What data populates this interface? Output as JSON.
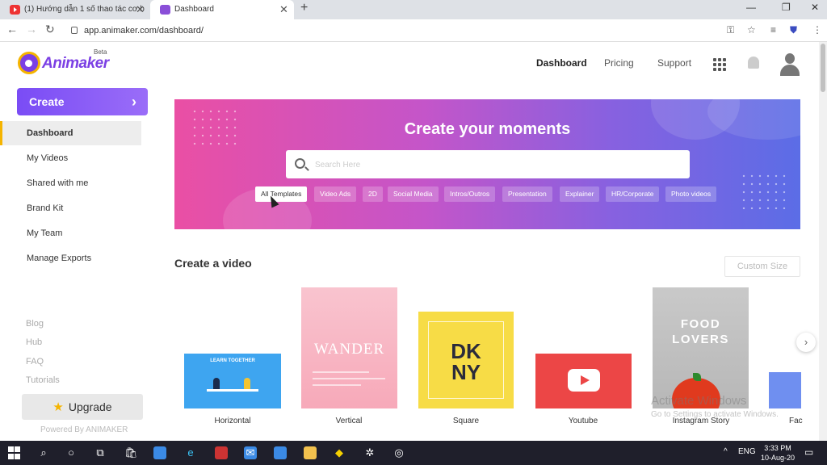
{
  "browser": {
    "tabs": [
      {
        "title": "(1) Hướng dẫn 1 số thao tác cơ b"
      },
      {
        "title": "Dashboard"
      }
    ],
    "url": "app.animaker.com/dashboard/"
  },
  "header": {
    "logo_text": "Animaker",
    "logo_badge": "Beta",
    "nav": [
      "Dashboard",
      "Pricing",
      "Support"
    ]
  },
  "sidebar": {
    "create_label": "Create",
    "items": [
      {
        "label": "Dashboard"
      },
      {
        "label": "My Videos"
      },
      {
        "label": "Shared with me"
      },
      {
        "label": "Brand Kit"
      },
      {
        "label": "My Team"
      },
      {
        "label": "Manage Exports"
      }
    ],
    "links": [
      "Blog",
      "Hub",
      "FAQ",
      "Tutorials"
    ],
    "upgrade_label": "Upgrade",
    "powered_by": "Powered By ANIMAKER"
  },
  "banner": {
    "title": "Create your moments",
    "search_placeholder": "Search Here",
    "chips": [
      "All Templates",
      "Video Ads",
      "2D",
      "Social Media",
      "Intros/Outros",
      "Presentation",
      "Explainer",
      "HR/Corporate",
      "Photo videos"
    ],
    "active_chip": "All Templates"
  },
  "create_video": {
    "title": "Create a video",
    "custom_size_label": "Custom Size",
    "cards": [
      {
        "label": "Horizontal",
        "thumb_text": "LEARN TOGETHER"
      },
      {
        "label": "Vertical",
        "thumb_text": "WANDER"
      },
      {
        "label": "Square",
        "thumb_text_1": "DK",
        "thumb_text_2": "NY"
      },
      {
        "label": "Youtube"
      },
      {
        "label": "Instagram Story",
        "thumb_text_1": "FOOD",
        "thumb_text_2": "LOVERS"
      },
      {
        "label": "Fac"
      }
    ]
  },
  "watermark": {
    "line1": "Activate Windows",
    "line2": "Go to Settings to activate Windows."
  },
  "taskbar": {
    "language": "ENG",
    "time": "3:33 PM",
    "date": "10-Aug-20"
  },
  "colors": {
    "accent_purple": "#7a4cf5",
    "accent_yellow": "#f5b400"
  }
}
